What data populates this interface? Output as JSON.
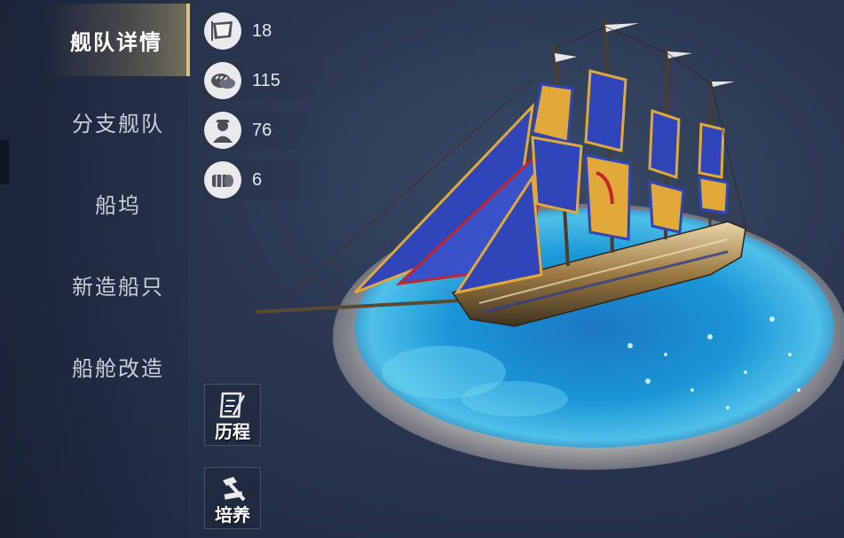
{
  "nav": {
    "items": [
      {
        "label": "舰队详情",
        "active": true
      },
      {
        "label": "分支舰队",
        "active": false
      },
      {
        "label": "船坞",
        "active": false
      },
      {
        "label": "新造船只",
        "active": false
      },
      {
        "label": "船舱改造",
        "active": false
      }
    ]
  },
  "stats": [
    {
      "icon": "sail-icon",
      "value": "18"
    },
    {
      "icon": "bread-icon",
      "value": "115"
    },
    {
      "icon": "sailor-icon",
      "value": "76"
    },
    {
      "icon": "barrel-icon",
      "value": "6"
    }
  ],
  "actions": {
    "history_label": "历程",
    "train_label": "培养"
  },
  "colors": {
    "accent_gold": "#d7c28a",
    "sail_blue": "#2f45b8",
    "sail_gold": "#e0a93a",
    "sail_red": "#c0262e",
    "sea_blue": "#1f8fd0"
  }
}
